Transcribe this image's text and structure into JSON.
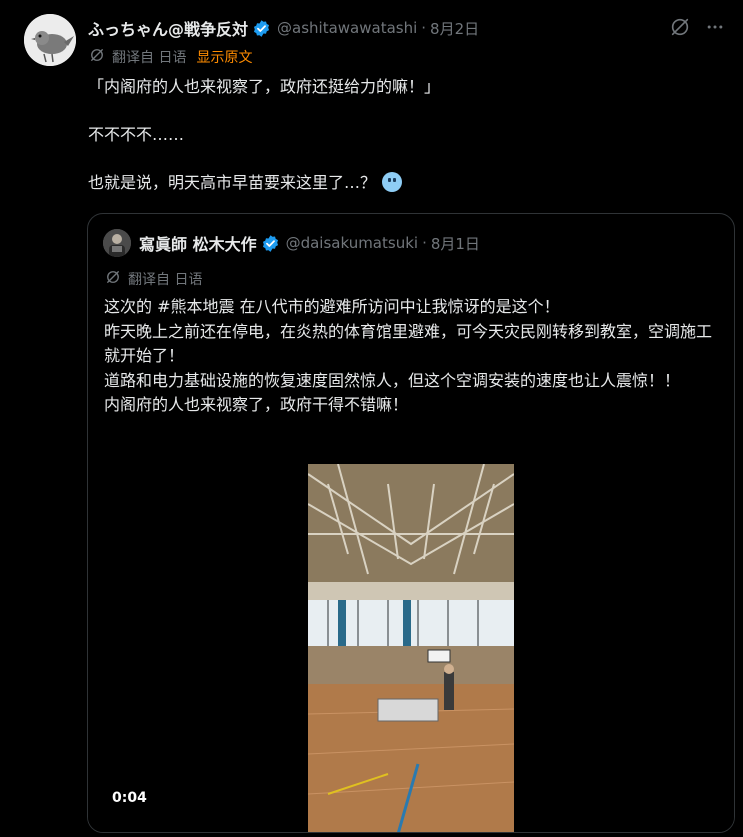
{
  "tweet": {
    "author_name": "ふっちゃん@戦争反対",
    "handle": "@ashitawawatashi",
    "separator": "·",
    "date": "8月2日",
    "translate_label": "翻译自 日语",
    "show_original": "显示原文",
    "text_lines": [
      "「内阁府的人也来视察了，政府还挺给力的嘛！」",
      "不不不不……",
      "也就是说，明天高市早苗要来这里了…？"
    ]
  },
  "quote": {
    "author_name": "寫眞師 松木大作",
    "handle": "@daisakumatsuki",
    "separator": "·",
    "date": "8月1日",
    "translate_label": "翻译自 日语",
    "text_lines": [
      "这次的 #熊本地震 在八代市的避难所访问中让我惊讶的是这个！",
      "昨天晚上之前还在停电，在炎热的体育馆里避难，可今天灾民刚转移到教室，空调施工就开始了！",
      "道路和电力基础设施的恢复速度固然惊人，但这个空调安装的速度也让人震惊！！",
      "内阁府的人也来视察了，政府干得不错嘛！"
    ],
    "video_time": "0:04"
  },
  "colors": {
    "background": "#000000",
    "text": "#e7e9ea",
    "muted": "#71767b",
    "verified": "#1d9bf0",
    "show_original": "#ff8c00"
  },
  "icons": {
    "verified": "verified-badge-icon",
    "grok": "grok-icon",
    "more": "more-icon",
    "translate": "translate-icon"
  }
}
